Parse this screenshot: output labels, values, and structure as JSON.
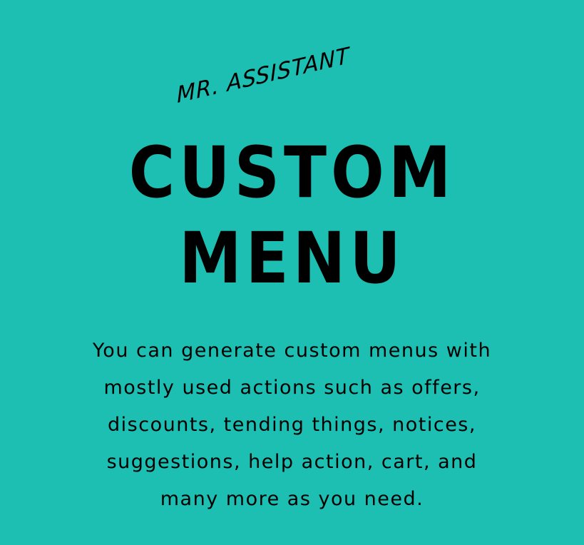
{
  "brand": "MR. ASSISTANT",
  "title": {
    "line1": "CUSTOM",
    "line2": "MENU"
  },
  "description": [
    "You can generate custom menus with",
    "mostly used actions such as offers,",
    "discounts, tending things, notices,",
    "suggestions, help action, cart, and",
    "many more as you need."
  ],
  "colors": {
    "background": "#1cbfb2",
    "text": "#000000"
  }
}
